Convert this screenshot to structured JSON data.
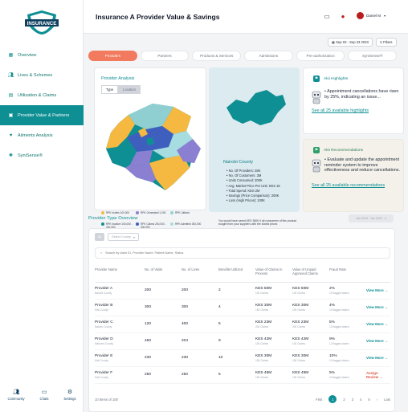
{
  "app": {
    "logo_text": "INSURANCE"
  },
  "sidebar": {
    "items": [
      {
        "label": "Overview",
        "icon": "grid-icon"
      },
      {
        "label": "Lives & Schemes",
        "icon": "people-icon"
      },
      {
        "label": "Utilization & Claims",
        "icon": "chart-icon"
      },
      {
        "label": "Provider Value & Partners",
        "icon": "building-icon",
        "active": true
      },
      {
        "label": "Ailments Analysis",
        "icon": "heart-icon"
      },
      {
        "label": "SyniSense®",
        "icon": "sparkle-icon"
      }
    ],
    "bottom": [
      {
        "label": "Community",
        "icon": "community-icon"
      },
      {
        "label": "Chats",
        "icon": "chat-icon"
      },
      {
        "label": "Settings",
        "icon": "gear-icon"
      }
    ]
  },
  "header": {
    "title": "Insurance A Provider Value & Savings",
    "user_name": "Daniel M"
  },
  "filters": {
    "date_range": "Sep 03 - Sep 23 2023",
    "filters_label": "Filters"
  },
  "tabs": [
    "Providers",
    "Partners",
    "Products & Services",
    "Admissions",
    "Pre-authorization",
    "SyniSense®"
  ],
  "provider_analysis": {
    "title": "Provider Analysis",
    "toggle": [
      "Type",
      "Location"
    ],
    "legend": [
      {
        "label": "RPK Invites 100,000",
        "color": "#f5b941"
      },
      {
        "label": "RPK Generated 1,000",
        "color": "#8b7fd1"
      },
      {
        "label": "RPK Utilized",
        "color": "#93d3d6"
      },
      {
        "label": "RPK Inactive 100,000 - 200,000",
        "color": "#0e8f94"
      },
      {
        "label": "RPK Claims 200,000 - 300,000",
        "color": "#3f5fbf"
      },
      {
        "label": "RPK Admitted 300,000",
        "color": "#a7dde0"
      }
    ]
  },
  "county": {
    "name": "Nairobi County",
    "stats": [
      "No. Of Providers: 28K",
      "No. Of Customers: 3M",
      "Units Consumed: 200K",
      "Avg. Market Price Per Unit: KES 15",
      "Total Spend: KES 2M",
      "Savings (Price Comparison): 200K",
      "Loss (High Prices): 100K"
    ],
    "note": "You would have saved KES 380K if all consumers of this product bought from your suppliers with the lowest prices"
  },
  "highlights": {
    "title": "Akii Highlights",
    "text": "Appointment cancellations have risen by 25%, indicating an issue...",
    "link": "See all 25 available highlights"
  },
  "recommendations": {
    "title": "Akii Recommendations",
    "text": "Evaluate and update the appointment reminder system to improve effectiveness and reduce cancellations.",
    "link": "See all 25 available recommendations"
  },
  "provider_type": {
    "title": "Provider Type Overview",
    "date": "Jan 2023 - Jan 2024",
    "filter_all": "All",
    "filter_county": "Select County",
    "search_placeholder": "Search by claim ID, Provider Name, Patient Name, Status",
    "columns": [
      "Provider Name",
      "No. of Visits",
      "No. of Lives",
      "Benefits Utilized",
      "Value of Claims in Process",
      "Value of Unpaid Approved Claims",
      "Fraud Rate",
      ""
    ],
    "rows": [
      {
        "name": "Provider A",
        "county": "Nairobi County",
        "visits": "200",
        "lives": "200",
        "benefits": "2",
        "claims": "KES 50M",
        "claims_sub": "100 Claims",
        "unpaid": "KES 50M",
        "unpaid_sub": "100 Claims",
        "fraud": "2%",
        "fraud_sub": "10 flagged claims",
        "action": "View More →"
      },
      {
        "name": "Provider B",
        "county": "Kisii County",
        "visits": "300",
        "lives": "300",
        "benefits": "4",
        "claims": "KES 30M",
        "claims_sub": "150 Claims",
        "unpaid": "KES 30M",
        "unpaid_sub": "150 Claims",
        "fraud": "4%",
        "fraud_sub": "10 flagged claims",
        "action": "View More →"
      },
      {
        "name": "Provider C",
        "county": "Nakuru County",
        "visits": "120",
        "lives": "400",
        "benefits": "5",
        "claims": "KES 23M",
        "claims_sub": "200 Claims",
        "unpaid": "KES 23M",
        "unpaid_sub": "200 Claims",
        "fraud": "5%",
        "fraud_sub": "12 flagged claims",
        "action": "View More →"
      },
      {
        "name": "Provider D",
        "county": "Makueni County",
        "visits": "450",
        "lives": "204",
        "benefits": "9",
        "claims": "KES 42M",
        "claims_sub": "100 Claims",
        "unpaid": "KES 42M",
        "unpaid_sub": "100 Claims",
        "fraud": "9%",
        "fraud_sub": "12 flagged claims",
        "action": "View More →"
      },
      {
        "name": "Provider E",
        "county": "Kisii County",
        "visits": "230",
        "lives": "230",
        "benefits": "10",
        "claims": "KES 30M",
        "claims_sub": "150 Claims",
        "unpaid": "KES 30M",
        "unpaid_sub": "150 Claims",
        "fraud": "10%",
        "fraud_sub": "10 flagged claims",
        "action": "View More →"
      },
      {
        "name": "Provider F",
        "county": "Kisii County",
        "visits": "250",
        "lives": "250",
        "benefits": "5",
        "claims": "KES 45M",
        "claims_sub": "150 Claims",
        "unpaid": "KES 45M",
        "unpaid_sub": "150 Claims",
        "fraud": "5%",
        "fraud_sub": "10 flagged claims",
        "action": "Assign Review →",
        "alert": true
      }
    ],
    "footer_count": "10 Items of 100",
    "pager": {
      "first": "First",
      "pages": [
        "1",
        "2",
        "3",
        "4",
        "5"
      ],
      "current": "1",
      "last": "Last"
    }
  },
  "colors": {
    "accent": "#0e8f94",
    "tab_active": "#f27a5e",
    "alert": "#e0564a"
  }
}
